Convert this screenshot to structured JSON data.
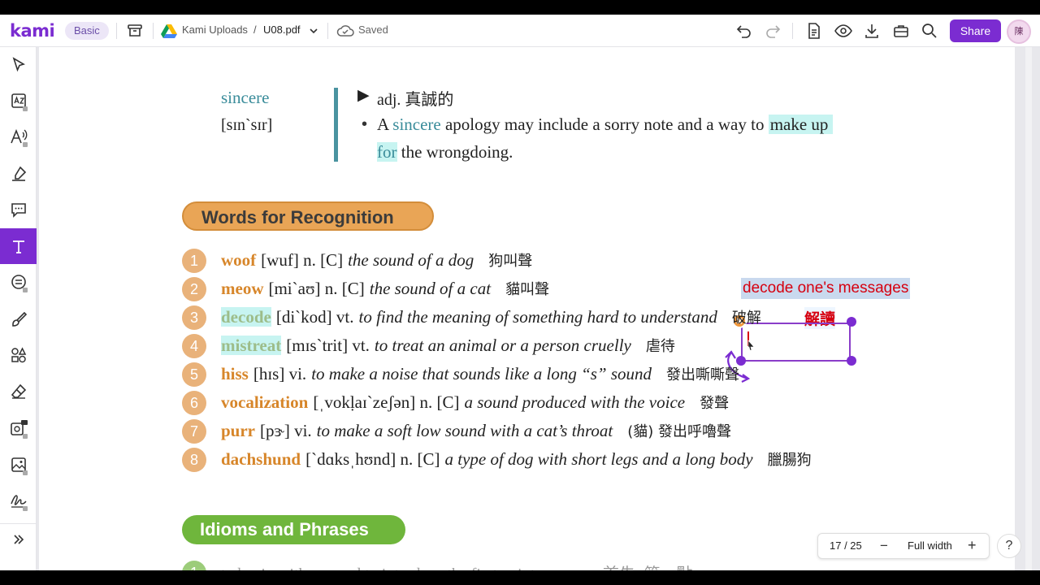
{
  "app": {
    "logo": "kami",
    "plan_badge": "Basic",
    "breadcrumb_root": "Kami Uploads",
    "breadcrumb_sep": "/",
    "file_name": "U08.pdf",
    "save_status": "Saved",
    "share_label": "Share",
    "avatar_initial": "陳"
  },
  "vocab_entry": {
    "word": "sincere",
    "pron": "[sɪn`sɪr]",
    "pos_marker": "▶",
    "pos": "adj. 真誠的",
    "bullet": "•",
    "ex_a": "A",
    "ex_word": "sincere",
    "ex_mid": "apology may include a sorry note and a way to",
    "ex_hl1": "make up",
    "ex_hl2": "for",
    "ex_end": "the wrongdoing."
  },
  "recognition": {
    "heading": "Words for Recognition",
    "items": [
      {
        "n": "1",
        "word": "woof",
        "pron": "[wuf] n. [C]",
        "def": "the sound of a dog",
        "zh": "狗叫聲"
      },
      {
        "n": "2",
        "word": "meow",
        "pron": "[mi`aʊ] n. [C]",
        "def": "the sound of a cat",
        "zh": "貓叫聲"
      },
      {
        "n": "3",
        "word": "decode",
        "pron": "[di`kod] vt.",
        "def": "to find the meaning of something hard to understand",
        "zh": "破解"
      },
      {
        "n": "4",
        "word": "mistreat",
        "pron": "[mɪs`trit] vt.",
        "def": "to treat an animal or a person cruelly",
        "zh": "虐待"
      },
      {
        "n": "5",
        "word": "hiss",
        "pron": "[hɪs] vi.",
        "def": "to make a noise that sounds like a long “s” sound",
        "zh": "發出嘶嘶聲"
      },
      {
        "n": "6",
        "word": "vocalization",
        "pron": "[ˌvokḷaɪ`zeʃən] n. [C]",
        "def": "a sound produced with the voice",
        "zh": "發聲"
      },
      {
        "n": "7",
        "word": "purr",
        "pron": "[pɝ] vi.",
        "def": "to make a soft low sound with a cat’s throat",
        "zh": "(貓) 發出呼嚕聲"
      },
      {
        "n": "8",
        "word": "dachshund",
        "pron": "[`dɑksˌhʊnd] n. [C]",
        "def": "a type of dog with short legs and a long body",
        "zh": "臘腸狗"
      }
    ]
  },
  "annotations": {
    "note1": "decode one's messages",
    "note2": "解讀"
  },
  "idioms": {
    "heading": "Idioms and Phrases",
    "first_n": "1",
    "first_text": "to begin with — used to introduce the first point or reason 首先; 第一點"
  },
  "pager": {
    "page_indicator": "17 / 25",
    "zoom_out": "−",
    "zoom_label": "Full width",
    "zoom_in": "+",
    "help": "?"
  },
  "colors": {
    "brand": "#7b2cd1",
    "teal": "#3a8c9a",
    "orange": "#d7862a",
    "ribbon_orange": "#e9a556",
    "ribbon_green": "#6fb63c",
    "highlight": "#c7f4f1",
    "annotation_red": "#d6000f"
  }
}
